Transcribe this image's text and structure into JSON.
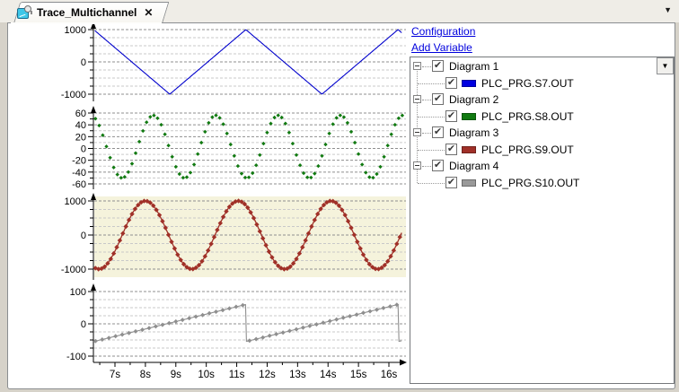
{
  "tab": {
    "title": "Trace_Multichannel",
    "close_glyph": "✕"
  },
  "tab_strip": {
    "overflow_arrow": "▼"
  },
  "links": {
    "configuration": "Configuration",
    "add_variable": "Add Variable"
  },
  "tree": {
    "dropdown_arrow": "▼",
    "items": [
      {
        "label": "Diagram 1",
        "checked": true,
        "expanded": true,
        "children": [
          {
            "label": "PLC_PRG.S7.OUT",
            "checked": true,
            "color": "#0000e0"
          }
        ]
      },
      {
        "label": "Diagram 2",
        "checked": true,
        "expanded": true,
        "children": [
          {
            "label": "PLC_PRG.S8.OUT",
            "checked": true,
            "color": "#117a11"
          }
        ]
      },
      {
        "label": "Diagram 3",
        "checked": true,
        "expanded": true,
        "children": [
          {
            "label": "PLC_PRG.S9.OUT",
            "checked": true,
            "color": "#a03028"
          }
        ]
      },
      {
        "label": "Diagram 4",
        "checked": true,
        "expanded": true,
        "children": [
          {
            "label": "PLC_PRG.S10.OUT",
            "checked": true,
            "color": "#999999"
          }
        ]
      }
    ]
  },
  "chart_data": {
    "type": "line",
    "title": "Trace_Multichannel",
    "x_axis": {
      "unit": "s",
      "xlim": [
        6.34,
        16.44
      ],
      "ticks": [
        7,
        8,
        9,
        10,
        11,
        12,
        13,
        14,
        15,
        16
      ],
      "tick_labels": [
        "7s",
        "8s",
        "9s",
        "10s",
        "11s",
        "12s",
        "13s",
        "14s",
        "15s",
        "16s"
      ],
      "minor_step_s": 0.5
    },
    "panels": [
      {
        "name": "Diagram 1",
        "variable": "PLC_PRG.S7.OUT",
        "style": "line",
        "color": "#0000cc",
        "ylim": [
          -1000,
          1000
        ],
        "y_tick_labels": [
          "1000",
          "0",
          "-1000"
        ],
        "y_label_step": 1000,
        "y_minor_step": 250,
        "waveform": {
          "shape": "triangle",
          "amplitude": 1000,
          "period_s": 5,
          "peak_at_s": 11.3
        }
      },
      {
        "name": "Diagram 2",
        "variable": "PLC_PRG.S8.OUT",
        "style": "scatter",
        "color": "#117a11",
        "ylim": [
          -60,
          60
        ],
        "y_tick_labels": [
          "60",
          "40",
          "20",
          "0",
          "-20",
          "-40",
          "-60"
        ],
        "y_label_step": 20,
        "y_minor_step": 10,
        "waveform": {
          "shape": "sine",
          "amplitude": 53,
          "offset": 3,
          "period_s": 2.05,
          "peak_at_s": 8.26,
          "sample_step_s": 0.12
        }
      },
      {
        "name": "Diagram 3",
        "variable": "PLC_PRG.S9.OUT",
        "style": "line-markers",
        "color": "#a03028",
        "plot_bg": "#f5f3dc",
        "ylim": [
          -1000,
          1000
        ],
        "y_tick_labels": [
          "1000",
          "0",
          "-1000"
        ],
        "y_label_step": 1000,
        "y_minor_step": 250,
        "waveform": {
          "shape": "sine",
          "amplitude": 1000,
          "offset": 0,
          "period_s": 3.05,
          "peak_at_s": 8.0,
          "sample_step_s": 0.1
        }
      },
      {
        "name": "Diagram 4",
        "variable": "PLC_PRG.S10.OUT",
        "style": "line-markers",
        "color": "#8f8f8f",
        "ylim": [
          -100,
          100
        ],
        "y_tick_labels": [
          "100",
          "0",
          "-100"
        ],
        "y_label_step": 100,
        "y_minor_step": 25,
        "waveform": {
          "shape": "sawtooth",
          "min": -55,
          "max": 60,
          "period_s": 5,
          "drop_at_s": 11.3,
          "sample_step_s": 0.22
        }
      }
    ]
  }
}
